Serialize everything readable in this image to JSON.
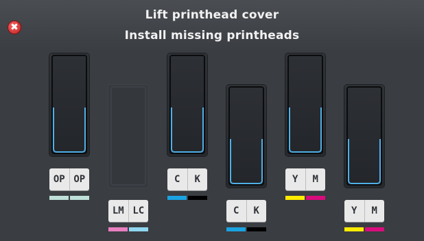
{
  "header": {
    "title": "Lift printhead cover",
    "subtitle": "Install missing printheads"
  },
  "close_button": {
    "label": "✖"
  },
  "slots": [
    {
      "labels": [
        "OP",
        "OP"
      ],
      "swatches": [
        "#bfe0d9",
        "#bfe0d9"
      ],
      "installed": true
    },
    {
      "labels": [
        "LM",
        "LC"
      ],
      "swatches": [
        "#e87fc0",
        "#8fd6f0"
      ],
      "installed": false
    },
    {
      "labels": [
        "C",
        "K"
      ],
      "swatches": [
        "#1aa2e1",
        "#000000"
      ],
      "installed": true
    },
    {
      "labels": [
        "C",
        "K"
      ],
      "swatches": [
        "#1aa2e1",
        "#000000"
      ],
      "installed": true
    },
    {
      "labels": [
        "Y",
        "M"
      ],
      "swatches": [
        "#ffeb00",
        "#d90c7d"
      ],
      "installed": true
    },
    {
      "labels": [
        "Y",
        "M"
      ],
      "swatches": [
        "#ffeb00",
        "#d90c7d"
      ],
      "installed": true
    }
  ]
}
